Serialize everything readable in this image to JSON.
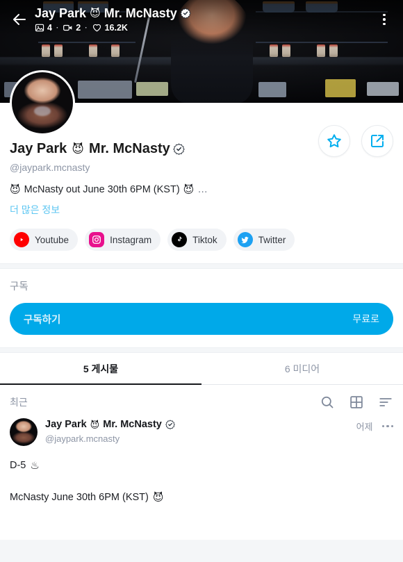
{
  "header": {
    "back_icon": "back-arrow-icon",
    "menu_icon": "more-vertical-icon",
    "title": "Jay Park",
    "title_emoji": "😈",
    "title_suffix": "Mr. McNasty",
    "verified_icon": "verified-badge-icon",
    "stats": {
      "photos_icon": "image-icon",
      "photos": "4",
      "videos_icon": "video-icon",
      "videos": "2",
      "likes_icon": "heart-icon",
      "likes": "16.2K",
      "separator": "·"
    }
  },
  "actions": {
    "favorite_icon": "star-icon",
    "share_icon": "share-icon",
    "accent_color": "#00aeef"
  },
  "profile": {
    "avatar_name": "profile-avatar",
    "name": "Jay Park",
    "name_emoji": "😈",
    "name_suffix": "Mr. McNasty",
    "verified_icon": "verified-badge-icon",
    "handle": "@jaypark.mcnasty",
    "bio_emoji_start": "😈",
    "bio": "McNasty out June 30th 6PM (KST)",
    "bio_emoji_end": "😈",
    "bio_ellipsis": "…",
    "more_link": "더 많은 정보",
    "more_link_color": "#5cc6f2"
  },
  "socials": [
    {
      "label": "Youtube",
      "icon": "youtube-icon",
      "color": "#ff0000"
    },
    {
      "label": "Instagram",
      "icon": "instagram-icon",
      "color": "#e8118d"
    },
    {
      "label": "Tiktok",
      "icon": "tiktok-icon",
      "color": "#000000"
    },
    {
      "label": "Twitter",
      "icon": "twitter-icon",
      "color": "#1da1f2"
    }
  ],
  "subscription": {
    "section_title": "구독",
    "button_label": "구독하기",
    "button_price": "무료로",
    "button_color": "#00a9e9"
  },
  "tabs": [
    {
      "label": "5 게시물",
      "active": true
    },
    {
      "label": "6 미디어",
      "active": false
    }
  ],
  "filter_bar": {
    "label": "최근",
    "search_icon": "search-icon",
    "grid_icon": "grid-view-icon",
    "sort_icon": "sort-icon"
  },
  "post": {
    "avatar_name": "post-avatar",
    "name": "Jay Park",
    "name_emoji": "😈",
    "name_suffix": "Mr. McNasty",
    "verified_icon": "verified-badge-icon",
    "handle": "@jaypark.mcnasty",
    "time": "어제",
    "menu_icon": "more-horizontal-icon",
    "line1": "D-5",
    "line1_emoji": "♨",
    "line2": "McNasty June 30th 6PM (KST)",
    "line2_emoji": "😈"
  }
}
